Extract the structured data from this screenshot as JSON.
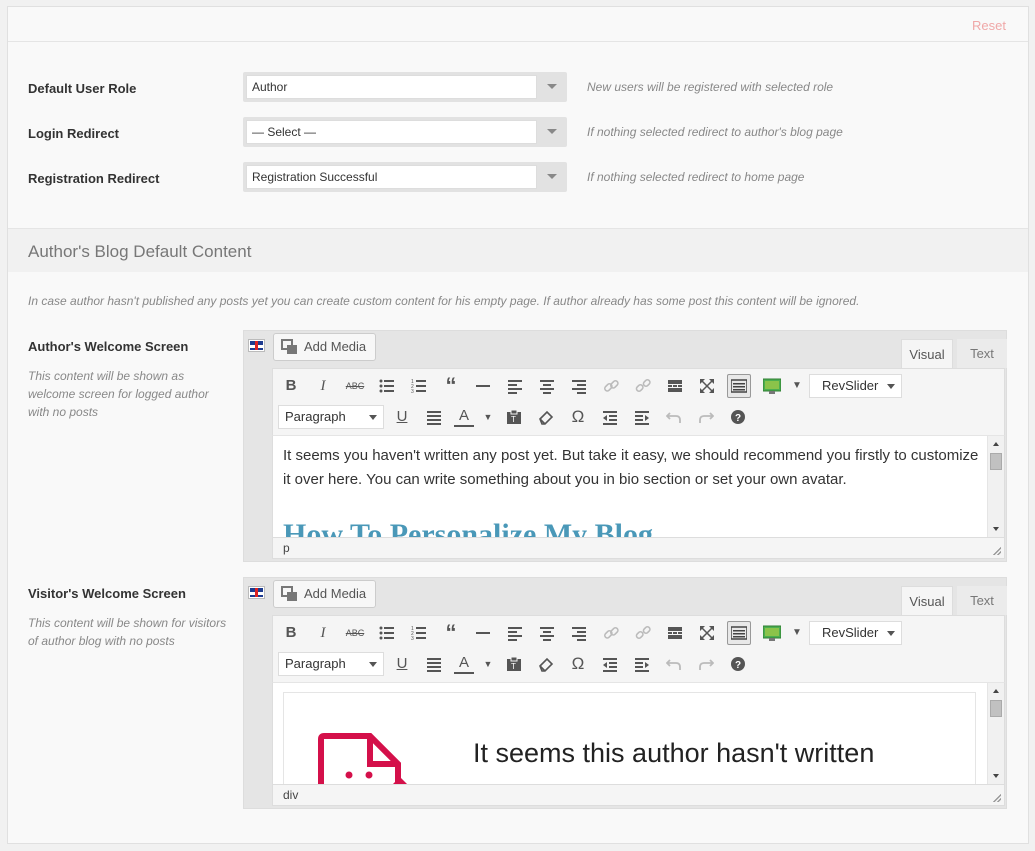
{
  "header": {
    "reset_label": "Reset"
  },
  "settings": [
    {
      "label": "Default User Role",
      "value": "Author",
      "hint": "New users will be registered with selected role"
    },
    {
      "label": "Login Redirect",
      "value": "— Select —",
      "hint": "If nothing selected redirect to author's blog page"
    },
    {
      "label": "Registration Redirect",
      "value": "Registration Successful",
      "hint": "If nothing selected redirect to home page"
    }
  ],
  "section": {
    "title": "Author's Blog Default Content",
    "intro": "In case author hasn't published any posts yet you can create custom content for his empty page. If author already has some post this content will be ignored."
  },
  "editors": [
    {
      "label": "Author's Welcome Screen",
      "description": "This content will be shown as welcome screen for logged author with no posts",
      "add_media": "Add Media",
      "tab_visual": "Visual",
      "tab_text": "Text",
      "format": "Paragraph",
      "shortcode": "RevSlider",
      "content_text": "It seems you haven't written any post yet. But take it easy, we should recommend you firstly to customize it over here. You can write something about you in bio section or set your own avatar.",
      "content_heading": "How To Personalize My Blog",
      "path": "p"
    },
    {
      "label": "Visitor's Welcome Screen",
      "description": "This content will be shown for visitors of author blog with no posts",
      "add_media": "Add Media",
      "tab_visual": "Visual",
      "tab_text": "Text",
      "format": "Paragraph",
      "shortcode": "RevSlider",
      "content_text": "It seems this author hasn't written",
      "path": "div"
    }
  ],
  "colors": {
    "accent": "#4a98b8",
    "reset": "#f0a8a8",
    "doc_icon": "#d4104a"
  }
}
